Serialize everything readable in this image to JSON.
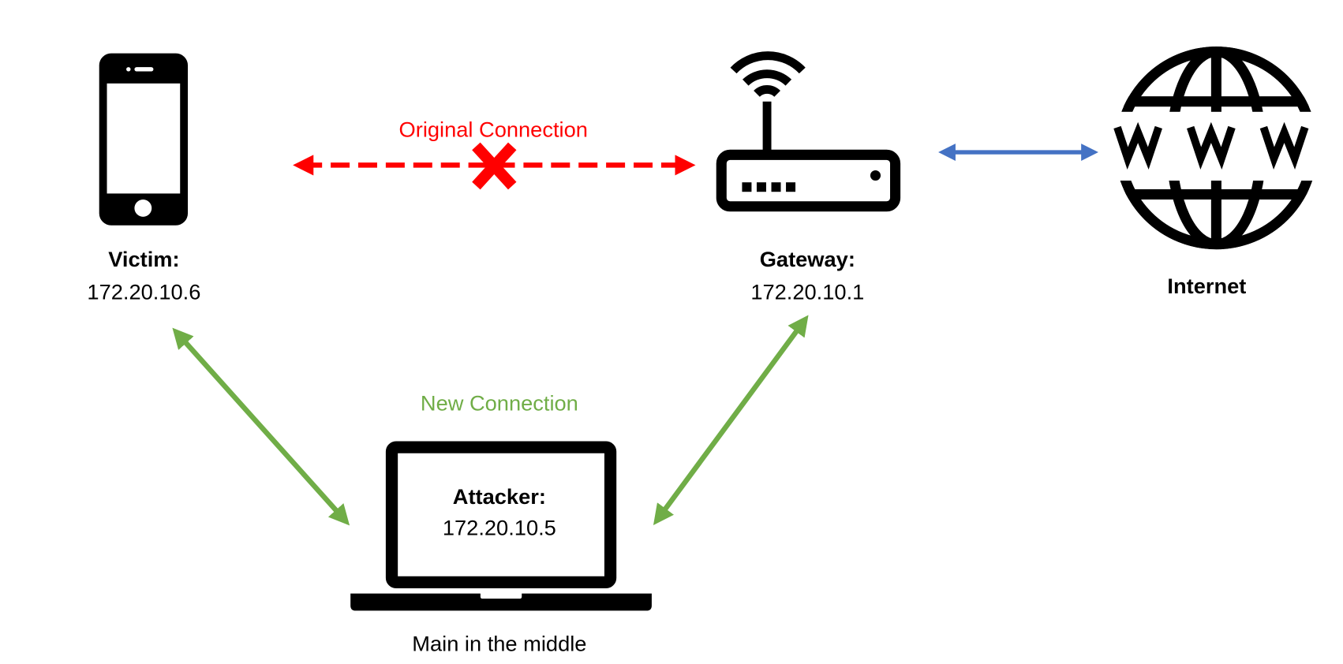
{
  "colors": {
    "original": "#ff0000",
    "new": "#70ad47",
    "internet_link": "#4472c4",
    "icon": "#000000"
  },
  "original_connection": {
    "label": "Original Connection",
    "status_icon": "x-icon"
  },
  "new_connection": {
    "label": "New Connection"
  },
  "victim": {
    "title": "Victim:",
    "ip": "172.20.10.6",
    "icon": "smartphone-icon"
  },
  "gateway": {
    "title": "Gateway:",
    "ip": "172.20.10.1",
    "icon": "wifi-router-icon"
  },
  "internet": {
    "title": "Internet",
    "icon": "globe-www-icon"
  },
  "attacker": {
    "title": "Attacker:",
    "ip": "172.20.10.5",
    "icon": "laptop-icon",
    "caption": "Main in the middle"
  }
}
